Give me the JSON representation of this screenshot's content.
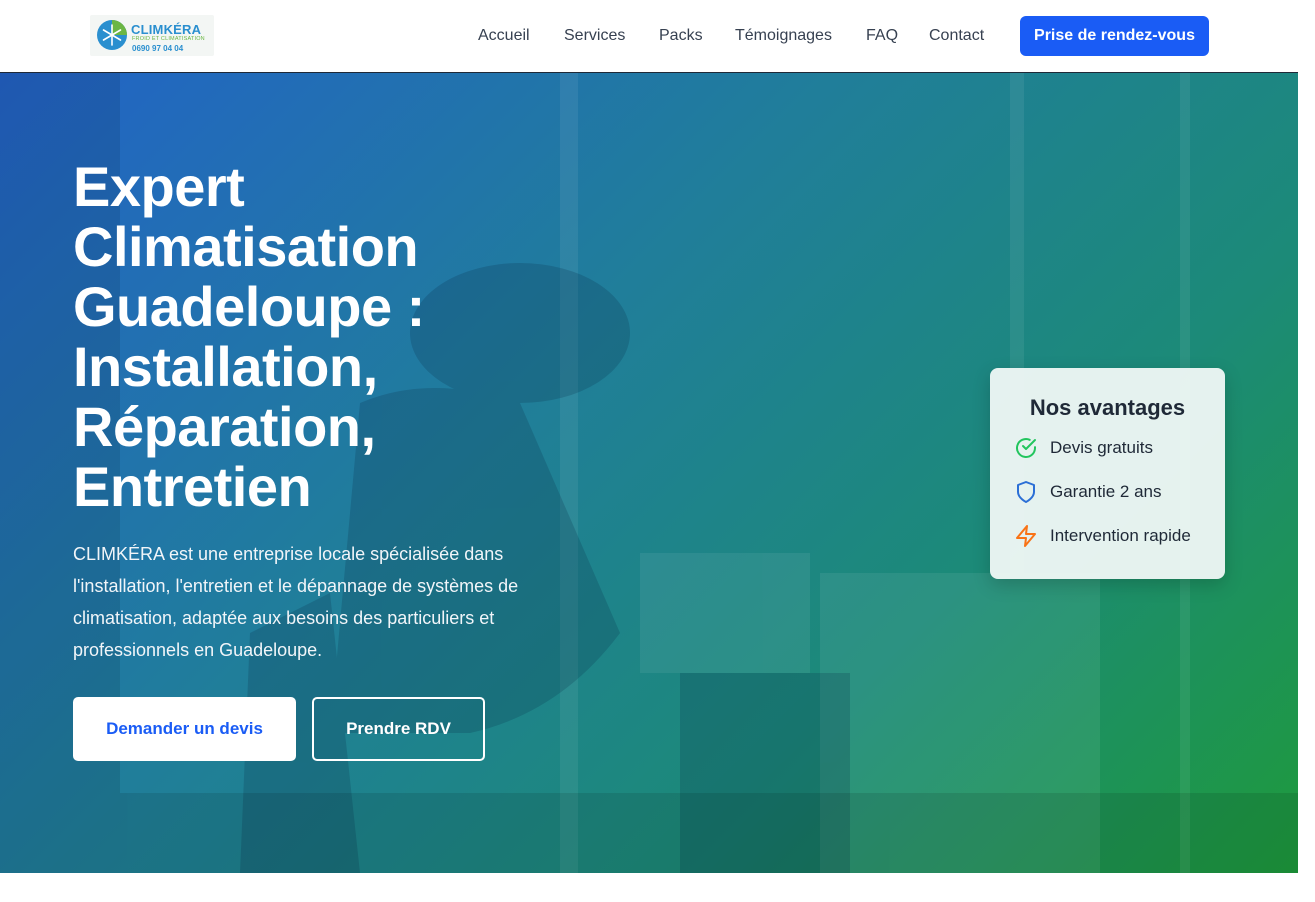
{
  "brand": {
    "name": "CLIMKÉRA",
    "tagline": "FROID ET CLIMATISATION",
    "phone": "0690 97 04 04"
  },
  "nav": {
    "items": [
      {
        "label": "Accueil"
      },
      {
        "label": "Services"
      },
      {
        "label": "Packs"
      },
      {
        "label": "Témoignages"
      },
      {
        "label": "FAQ"
      },
      {
        "label": "Contact"
      }
    ],
    "cta_label": "Prise de rendez-vous"
  },
  "hero": {
    "title": "Expert Climatisation Guadeloupe : Installation, Réparation, Entretien",
    "description": "CLIMKÉRA est une entreprise locale spécialisée dans l'installation, l'entretien et le dépannage de systèmes de climatisation, adaptée aux besoins des particuliers et professionnels en Guadeloupe.",
    "primary_button": "Demander un devis",
    "secondary_button": "Prendre RDV"
  },
  "advantages": {
    "title": "Nos avantages",
    "items": [
      {
        "label": "Devis gratuits",
        "icon": "check-circle-icon",
        "color": "#22c55e"
      },
      {
        "label": "Garantie 2 ans",
        "icon": "shield-icon",
        "color": "#2b6fd6"
      },
      {
        "label": "Intervention rapide",
        "icon": "lightning-icon",
        "color": "#f97316"
      }
    ]
  },
  "colors": {
    "primary": "#1a5cf5",
    "hero_gradient_start": "#2363c7",
    "hero_gradient_end": "#1e9a3c"
  }
}
